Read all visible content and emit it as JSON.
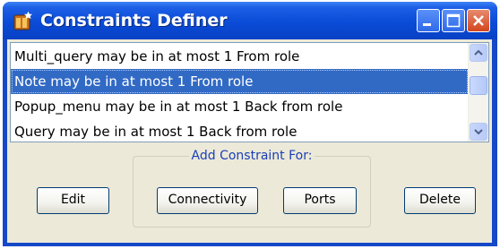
{
  "window": {
    "title": "Constraints Definer"
  },
  "constraints_list": {
    "items": [
      {
        "label": "Multi_query may be in at most 1 From role",
        "selected": false
      },
      {
        "label": "Note may be in at most 1 From role",
        "selected": true
      },
      {
        "label": "Popup_menu may be in at most 1 Back from role",
        "selected": false
      },
      {
        "label": "Query may be in at most 1 Back from role",
        "selected": false
      }
    ]
  },
  "add_constraint": {
    "group_label": "Add Constraint For:"
  },
  "buttons": {
    "edit": "Edit",
    "connectivity": "Connectivity",
    "ports": "Ports",
    "delete": "Delete"
  },
  "colors": {
    "titlebar": "#0a4bd7",
    "selection": "#316ac5",
    "dialog_face": "#ece9d8",
    "close_button": "#d2461e"
  },
  "icons": {
    "app": "app-logo-icon",
    "minimize": "minimize-icon",
    "maximize": "maximize-icon",
    "close": "close-icon",
    "scroll_up": "chevron-up-icon",
    "scroll_down": "chevron-down-icon"
  }
}
